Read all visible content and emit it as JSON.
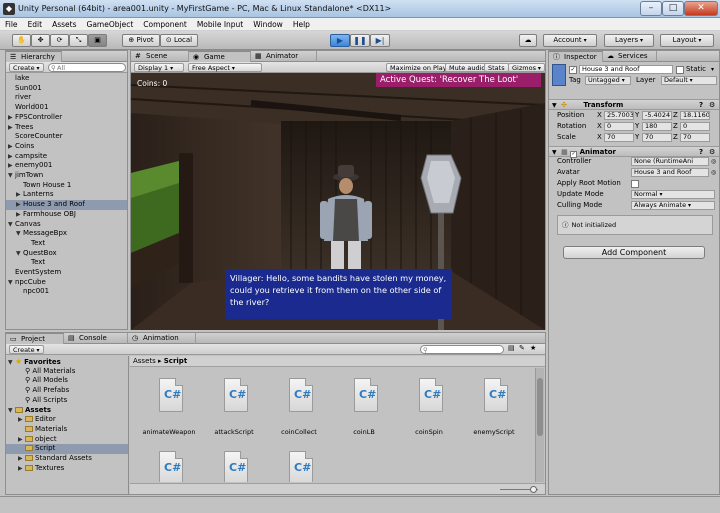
{
  "window": {
    "title": "Unity Personal (64bit) - area001.unity - MyFirstGame - PC, Mac & Linux Standalone* <DX11>",
    "min": "–",
    "max": "□",
    "close": "✕"
  },
  "menu": [
    "File",
    "Edit",
    "Assets",
    "GameObject",
    "Component",
    "Mobile Input",
    "Window",
    "Help"
  ],
  "toolbar": {
    "pivot": "Pivot",
    "local": "Local",
    "account": "Account",
    "layers": "Layers",
    "layout": "Layout"
  },
  "hierarchy": {
    "tab": "Hierarchy",
    "create": "Create",
    "search": "All",
    "items": [
      {
        "label": "lake",
        "indent": 0,
        "fold": ""
      },
      {
        "label": "Sun001",
        "indent": 0,
        "fold": ""
      },
      {
        "label": "river",
        "indent": 0,
        "fold": ""
      },
      {
        "label": "World001",
        "indent": 0,
        "fold": ""
      },
      {
        "label": "FPSController",
        "indent": 0,
        "fold": "▶"
      },
      {
        "label": "Trees",
        "indent": 0,
        "fold": "▶"
      },
      {
        "label": "ScoreCounter",
        "indent": 0,
        "fold": ""
      },
      {
        "label": "Coins",
        "indent": 0,
        "fold": "▶"
      },
      {
        "label": "campsite",
        "indent": 0,
        "fold": "▶"
      },
      {
        "label": "enemy001",
        "indent": 0,
        "fold": "▶"
      },
      {
        "label": "jimTown",
        "indent": 0,
        "fold": "▼"
      },
      {
        "label": "Town House 1",
        "indent": 1,
        "fold": ""
      },
      {
        "label": "Lanterns",
        "indent": 1,
        "fold": "▶"
      },
      {
        "label": "House 3 and Roof",
        "indent": 1,
        "fold": "▶",
        "selected": true
      },
      {
        "label": "Farmhouse OBJ",
        "indent": 1,
        "fold": "▶"
      },
      {
        "label": "Canvas",
        "indent": 0,
        "fold": "▼"
      },
      {
        "label": "MessageBpx",
        "indent": 1,
        "fold": "▼"
      },
      {
        "label": "Text",
        "indent": 2,
        "fold": ""
      },
      {
        "label": "QuestBox",
        "indent": 1,
        "fold": "▼"
      },
      {
        "label": "Text",
        "indent": 2,
        "fold": ""
      },
      {
        "label": "EventSystem",
        "indent": 0,
        "fold": ""
      },
      {
        "label": "npcCube",
        "indent": 0,
        "fold": "▼"
      },
      {
        "label": "npc001",
        "indent": 1,
        "fold": ""
      }
    ]
  },
  "game": {
    "tabs": [
      "Scene",
      "Game",
      "Animator"
    ],
    "display": "Display 1",
    "aspect": "Free Aspect",
    "toggles": [
      "Maximize on Play",
      "Mute audio",
      "Stats",
      "Gizmos"
    ],
    "coins": "Coins: 0",
    "quest": "Active Quest: 'Recover The Loot'",
    "dialog": "Villager: Hello, some bandits have stolen my money, could you retrieve it from them on the other side of the river?"
  },
  "inspector": {
    "tabs": [
      "Inspector",
      "Services"
    ],
    "object_name": "House 3 and Roof",
    "static": "Static",
    "tag_label": "Tag",
    "tag": "Untagged",
    "layer_label": "Layer",
    "layer": "Default",
    "transform": {
      "title": "Transform",
      "rows": [
        {
          "label": "Position",
          "x": "25.7003",
          "y": "-5.4024",
          "z": "18.1160"
        },
        {
          "label": "Rotation",
          "x": "0",
          "y": "180",
          "z": "0"
        },
        {
          "label": "Scale",
          "x": "70",
          "y": "70",
          "z": "70"
        }
      ]
    },
    "animator": {
      "title": "Animator",
      "controller_label": "Controller",
      "controller": "None (RuntimeAni",
      "avatar_label": "Avatar",
      "avatar": "House 3 and Roof",
      "root_label": "Apply Root Motion",
      "update_label": "Update Mode",
      "update": "Normal",
      "culling_label": "Culling Mode",
      "culling": "Always Animate",
      "status": "Not initialized"
    },
    "add_component": "Add Component"
  },
  "project": {
    "tabs": [
      "Project",
      "Console",
      "Animation"
    ],
    "create": "Create",
    "breadcrumb": [
      "Assets",
      "Script"
    ],
    "tree": [
      {
        "label": "Favorites",
        "indent": 0,
        "kind": "star",
        "bold": true,
        "fold": "▼"
      },
      {
        "label": "All Materials",
        "indent": 1,
        "kind": "search"
      },
      {
        "label": "All Models",
        "indent": 1,
        "kind": "search"
      },
      {
        "label": "All Prefabs",
        "indent": 1,
        "kind": "search"
      },
      {
        "label": "All Scripts",
        "indent": 1,
        "kind": "search"
      },
      {
        "label": "Assets",
        "indent": 0,
        "kind": "folder",
        "bold": true,
        "fold": "▼"
      },
      {
        "label": "Editor",
        "indent": 1,
        "kind": "folder",
        "fold": "▶"
      },
      {
        "label": "Materials",
        "indent": 1,
        "kind": "folder"
      },
      {
        "label": "object",
        "indent": 1,
        "kind": "folder",
        "fold": "▶"
      },
      {
        "label": "Script",
        "indent": 1,
        "kind": "folder",
        "selected": true
      },
      {
        "label": "Standard Assets",
        "indent": 1,
        "kind": "folder",
        "fold": "▶"
      },
      {
        "label": "Textures",
        "indent": 1,
        "kind": "folder",
        "fold": "▶"
      }
    ],
    "assets": [
      "animateWeapon",
      "attackScript",
      "coinCollect",
      "coinLB",
      "coinSpin",
      "enemyScript",
      "",
      "",
      ""
    ]
  }
}
